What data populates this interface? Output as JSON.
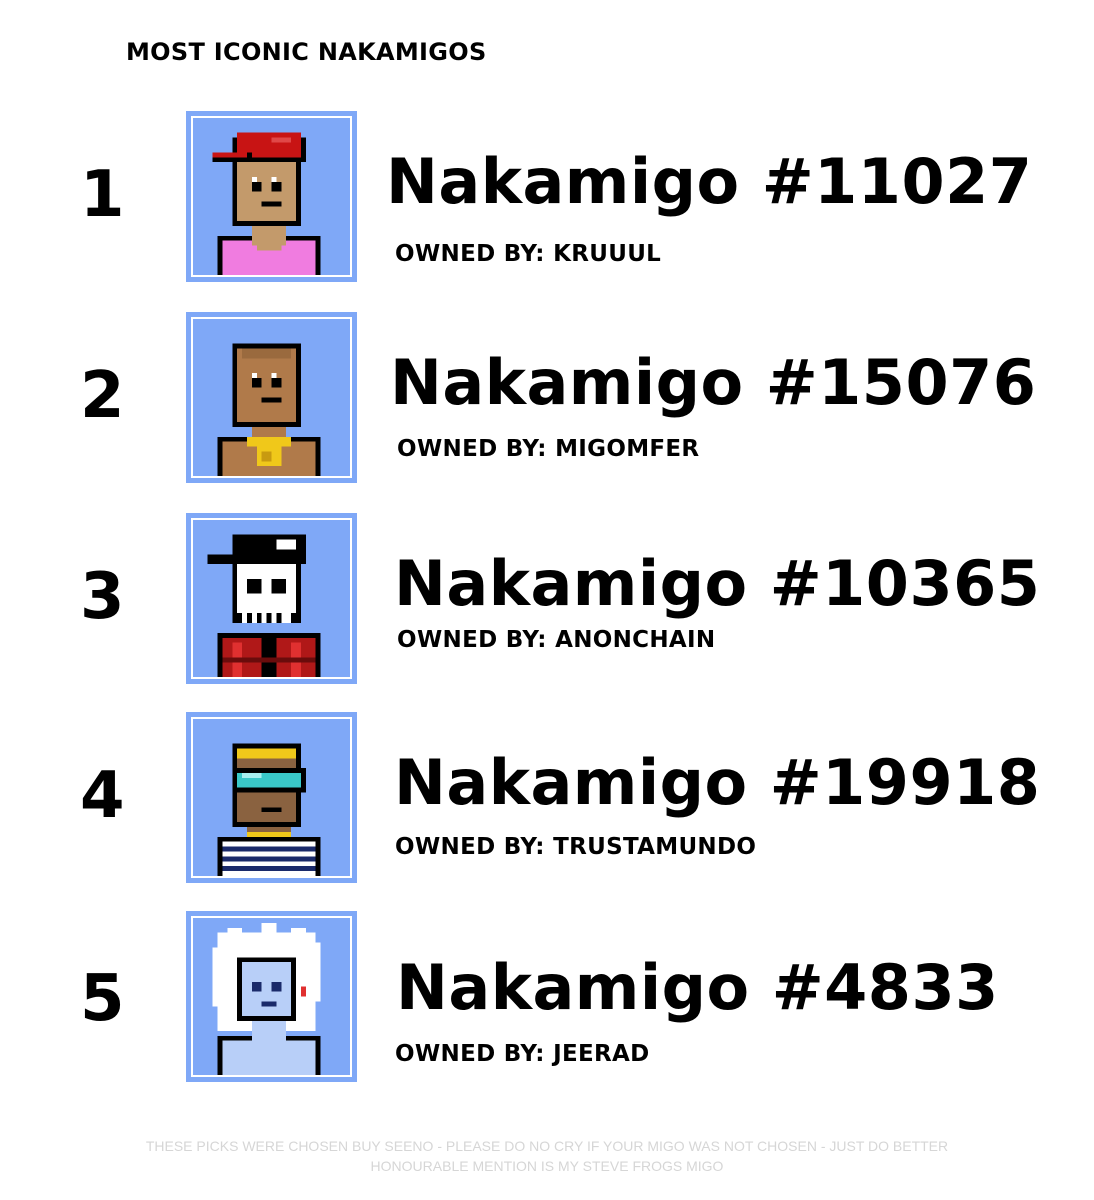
{
  "title": "MOST ICONIC NAKAMIGOS",
  "entries": [
    {
      "rank": "1",
      "name": "Nakamigo #11027",
      "owner": "OWNED BY: KRUUUL"
    },
    {
      "rank": "2",
      "name": "Nakamigo #15076",
      "owner": "OWNED BY: MIGOMFER"
    },
    {
      "rank": "3",
      "name": "Nakamigo #10365",
      "owner": "OWNED BY: ANONCHAIN"
    },
    {
      "rank": "4",
      "name": "Nakamigo #19918",
      "owner": "OWNED BY: TRUSTAMUNDO"
    },
    {
      "rank": "5",
      "name": "Nakamigo #4833",
      "owner": "OWNED BY: JEERAD"
    }
  ],
  "footer": {
    "line1": "THESE PICKS WERE CHOSEN BUY SEENO - PLEASE DO NO CRY IF YOUR MIGO WAS NOT CHOSEN - JUST DO BETTER",
    "line2": "HONOURABLE MENTION IS MY STEVE FROGS MIGO"
  },
  "colors": {
    "avatar_background": "#7fa8f7",
    "text": "#000000",
    "footer_text": "#d6d6d6"
  }
}
